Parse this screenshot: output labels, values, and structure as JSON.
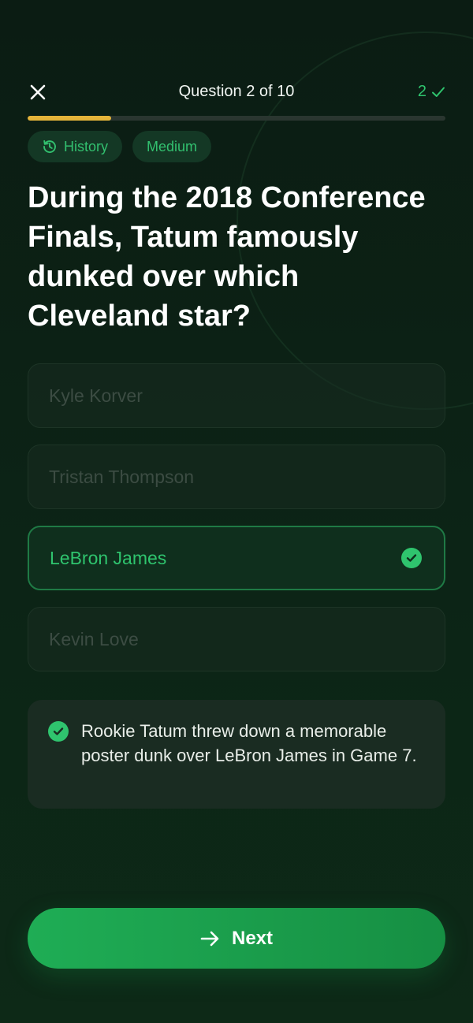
{
  "header": {
    "question_counter": "Question 2 of 10",
    "score": "2",
    "progress": 0.2
  },
  "tags": [
    {
      "label": "History",
      "icon": "history-icon"
    },
    {
      "label": "Medium"
    }
  ],
  "question": "During the 2018 Conference Finals, Tatum famously dunked over which Cleveland star?",
  "options": [
    {
      "label": "Kyle Korver",
      "state": "disabled"
    },
    {
      "label": "Tristan Thompson",
      "state": "disabled"
    },
    {
      "label": "LeBron James",
      "state": "correct"
    },
    {
      "label": "Kevin Love",
      "state": "disabled"
    }
  ],
  "explanation": "Rookie Tatum threw down a memorable poster dunk over LeBron James in Game 7.",
  "next_button": {
    "label": "Next"
  },
  "colors": {
    "accent_green": "#2fc46e",
    "progress_gold": "#e5b43a",
    "background": "#0b1c13"
  }
}
